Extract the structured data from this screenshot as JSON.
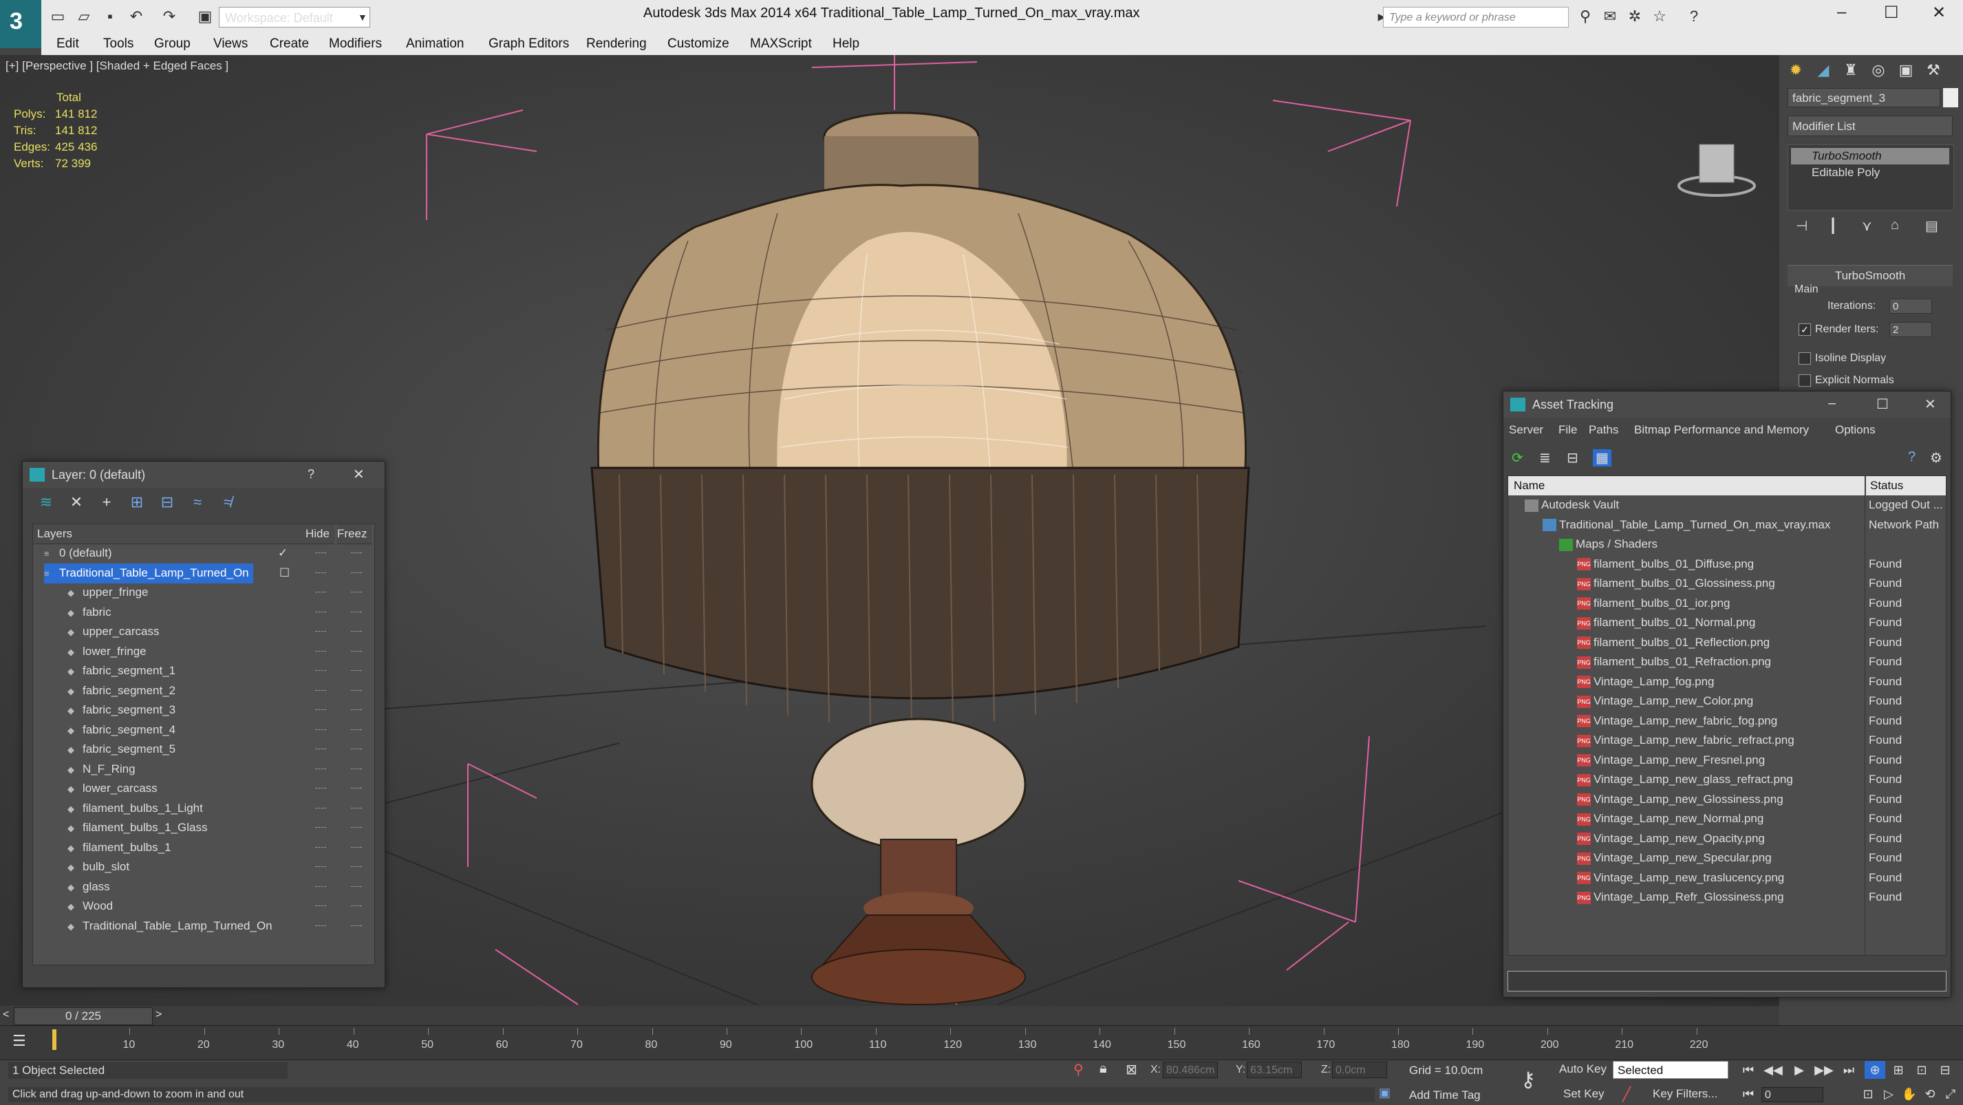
{
  "window": {
    "title": "Autodesk 3ds Max  2014 x64      Traditional_Table_Lamp_Turned_On_max_vray.max",
    "workspace": "Workspace: Default",
    "search_placeholder": "Type a keyword or phrase",
    "minimize": "–",
    "maximize": "☐",
    "close": "✕"
  },
  "menu": [
    "Edit",
    "Tools",
    "Group",
    "Views",
    "Create",
    "Modifiers",
    "Animation",
    "Graph Editors",
    "Rendering",
    "Customize",
    "MAXScript",
    "Help"
  ],
  "viewport": {
    "label": "[+] [Perspective ] [Shaded + Edged Faces ]",
    "stats": {
      "header": "Total",
      "rows": [
        {
          "k": "Polys:",
          "v": "141 812"
        },
        {
          "k": "Tris:",
          "v": "141 812"
        },
        {
          "k": "Edges:",
          "v": "425 436"
        },
        {
          "k": "Verts:",
          "v": "72 399"
        }
      ]
    }
  },
  "command_panel": {
    "object_name": "fabric_segment_3",
    "modifier_list": "Modifier List",
    "stack": [
      "TurboSmooth",
      "Editable Poly"
    ],
    "rollout": "TurboSmooth",
    "group": "Main",
    "iterations_label": "Iterations:",
    "iterations_value": "0",
    "render_iters_label": "Render Iters:",
    "render_iters_value": "2",
    "render_iters_checked": "✓",
    "isoline": "Isoline Display",
    "explicit_normals": "Explicit Normals"
  },
  "layer_dialog": {
    "title": "Layer: 0 (default)",
    "help": "?",
    "close": "✕",
    "columns": {
      "layers": "Layers",
      "hide": "Hide",
      "freeze": "Freez"
    },
    "rows": [
      {
        "name": "0 (default)",
        "mark": "✓"
      },
      {
        "name": "Traditional_Table_Lamp_Turned_On",
        "mark": "☐"
      },
      {
        "name": "upper_fringe"
      },
      {
        "name": "fabric"
      },
      {
        "name": "upper_carcass"
      },
      {
        "name": "lower_fringe"
      },
      {
        "name": "fabric_segment_1"
      },
      {
        "name": "fabric_segment_2"
      },
      {
        "name": "fabric_segment_3"
      },
      {
        "name": "fabric_segment_4"
      },
      {
        "name": "fabric_segment_5"
      },
      {
        "name": "N_F_Ring"
      },
      {
        "name": "lower_carcass"
      },
      {
        "name": "filament_bulbs_1_Light"
      },
      {
        "name": "filament_bulbs_1_Glass"
      },
      {
        "name": "filament_bulbs_1"
      },
      {
        "name": "bulb_slot"
      },
      {
        "name": "glass"
      },
      {
        "name": "Wood"
      },
      {
        "name": "Traditional_Table_Lamp_Turned_On"
      }
    ]
  },
  "asset_dialog": {
    "title": "Asset Tracking",
    "minimize": "–",
    "maximize": "☐",
    "close": "✕",
    "menu": [
      "Server",
      "File",
      "Paths",
      "Bitmap Performance and Memory",
      "Options"
    ],
    "columns": {
      "name": "Name",
      "status": "Status"
    },
    "rows": [
      {
        "name": "Autodesk Vault",
        "status": "Logged Out ..."
      },
      {
        "name": "Traditional_Table_Lamp_Turned_On_max_vray.max",
        "status": "Network Path"
      },
      {
        "name": "Maps / Shaders",
        "status": ""
      },
      {
        "name": "filament_bulbs_01_Diffuse.png",
        "status": "Found"
      },
      {
        "name": "filament_bulbs_01_Glossiness.png",
        "status": "Found"
      },
      {
        "name": "filament_bulbs_01_ior.png",
        "status": "Found"
      },
      {
        "name": "filament_bulbs_01_Normal.png",
        "status": "Found"
      },
      {
        "name": "filament_bulbs_01_Reflection.png",
        "status": "Found"
      },
      {
        "name": "filament_bulbs_01_Refraction.png",
        "status": "Found"
      },
      {
        "name": "Vintage_Lamp_fog.png",
        "status": "Found"
      },
      {
        "name": "Vintage_Lamp_new_Color.png",
        "status": "Found"
      },
      {
        "name": "Vintage_Lamp_new_fabric_fog.png",
        "status": "Found"
      },
      {
        "name": "Vintage_Lamp_new_fabric_refract.png",
        "status": "Found"
      },
      {
        "name": "Vintage_Lamp_new_Fresnel.png",
        "status": "Found"
      },
      {
        "name": "Vintage_Lamp_new_glass_refract.png",
        "status": "Found"
      },
      {
        "name": "Vintage_Lamp_new_Glossiness.png",
        "status": "Found"
      },
      {
        "name": "Vintage_Lamp_new_Normal.png",
        "status": "Found"
      },
      {
        "name": "Vintage_Lamp_new_Opacity.png",
        "status": "Found"
      },
      {
        "name": "Vintage_Lamp_new_Specular.png",
        "status": "Found"
      },
      {
        "name": "Vintage_Lamp_new_traslucency.png",
        "status": "Found"
      },
      {
        "name": "Vintage_Lamp_Refr_Glossiness.png",
        "status": "Found"
      }
    ]
  },
  "timeline": {
    "slider": "0 / 225",
    "ticks": [
      "10",
      "20",
      "30",
      "40",
      "50",
      "60",
      "70",
      "80",
      "90",
      "100",
      "110",
      "120",
      "130",
      "140",
      "150",
      "160",
      "170",
      "180",
      "190",
      "200",
      "210",
      "220"
    ]
  },
  "status": {
    "selection": "1 Object Selected",
    "prompt": "Click and drag up-and-down to zoom in and out",
    "x_label": "X:",
    "x": "80.486cm",
    "y_label": "Y:",
    "y": "63.15cm",
    "z_label": "Z:",
    "z": "0.0cm",
    "grid": "Grid = 10.0cm",
    "auto_key": "Auto Key",
    "set_key": "Set Key",
    "key_mode": "Selected",
    "key_filters": "Key Filters...",
    "add_time_tag": "Add Time Tag",
    "frame": "0"
  },
  "colors": {
    "viewport_bg": "#3a3a3a",
    "selection_blue": "#2c6dd2",
    "stats_yellow": "#e8e060",
    "bbox_pink": "#e060a0"
  }
}
